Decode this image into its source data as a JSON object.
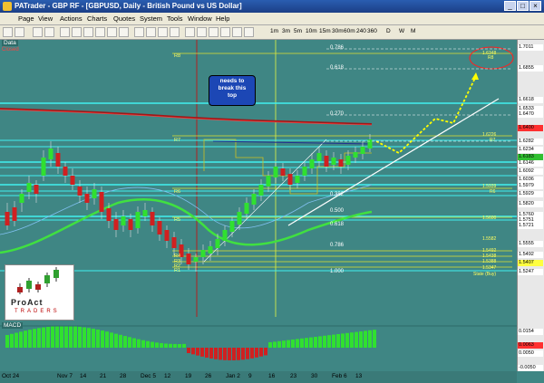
{
  "window": {
    "title": "PATrader - GBP RF - [GBPUSD, Daily - British Pound vs US Dollar]"
  },
  "menu": [
    "Page",
    "View",
    "Actions",
    "Charts",
    "Quotes",
    "System",
    "Tools",
    "Window",
    "Help"
  ],
  "timeframes": [
    "1m",
    "3m",
    "5m",
    "10m",
    "15m",
    "30m",
    "60m",
    "240",
    "360",
    "D",
    "W",
    "M"
  ],
  "panels": {
    "data_label": "Data",
    "closed_label": "Closed",
    "macd_label": "MACD"
  },
  "callout": {
    "line1": "needs to",
    "line2": "break this",
    "line3": "top"
  },
  "logo": {
    "text1": "ProAct",
    "text2": "TRADERS"
  },
  "fib_labels": [
    {
      "text": "0.786",
      "color": "#ffffff"
    },
    {
      "text": "0.618",
      "color": "#ffffff"
    },
    {
      "text": "0.270",
      "color": "#ffffff"
    },
    {
      "text": "0.382",
      "color": "#ffffff"
    },
    {
      "text": "0.500",
      "color": "#ffffff"
    },
    {
      "text": "0.618",
      "color": "#ffffff"
    },
    {
      "text": "0.786",
      "color": "#ffffff"
    },
    {
      "text": "1.000",
      "color": "#ffffff"
    }
  ],
  "pivot_labels": [
    "R8",
    "R7",
    "R6",
    "R5",
    "R4",
    "R3",
    "R2",
    "R1"
  ],
  "right_small_labels": [
    "1.6348",
    "R8",
    "1.6226",
    "R7",
    "1.5939",
    "R6",
    "1.5600",
    "1.5582",
    "1.5492",
    "1.5438",
    "1.5388",
    "1.5347",
    "State (Buy)"
  ],
  "price_axis": [
    {
      "text": "1.7011",
      "bg": "#ffffff"
    },
    {
      "text": "1.6855",
      "bg": "#ffffff"
    },
    {
      "text": "1.6618",
      "bg": "#ffffff"
    },
    {
      "text": "1.6533",
      "bg": "#ffffff"
    },
    {
      "text": "1.6470",
      "bg": "#ffffff"
    },
    {
      "text": "1.6400",
      "bg": "#ff3030"
    },
    {
      "text": "1.6282",
      "bg": "#ffffff"
    },
    {
      "text": "1.6234",
      "bg": "#ffffff"
    },
    {
      "text": "1.6183",
      "bg": "#30c030"
    },
    {
      "text": "1.6146",
      "bg": "#ffffff"
    },
    {
      "text": "1.6092",
      "bg": "#ffffff"
    },
    {
      "text": "1.6036",
      "bg": "#ffffff"
    },
    {
      "text": "1.5979",
      "bg": "#ffffff"
    },
    {
      "text": "1.5929",
      "bg": "#ffffff"
    },
    {
      "text": "1.5820",
      "bg": "#ffffff"
    },
    {
      "text": "1.5760",
      "bg": "#ffffff"
    },
    {
      "text": "1.5751",
      "bg": "#ffffff"
    },
    {
      "text": "1.5721",
      "bg": "#ffffff"
    },
    {
      "text": "1.5555",
      "bg": "#ffffff"
    },
    {
      "text": "1.5492",
      "bg": "#ffffff"
    },
    {
      "text": "1.5407",
      "bg": "#ffff40"
    },
    {
      "text": "1.5247",
      "bg": "#ffffff"
    }
  ],
  "macd_axis": [
    {
      "text": "0.0154",
      "bg": "#ffffff"
    },
    {
      "text": "0.0063",
      "bg": "#ff3030"
    },
    {
      "text": "0.0050",
      "bg": "#ffffff"
    },
    {
      "text": "-0.0050",
      "bg": "#ffffff"
    }
  ],
  "date_axis": [
    "Oct 24",
    "Nov 7",
    "14",
    "21",
    "28",
    "Dec 5",
    "12",
    "19",
    "26",
    "Jan 2",
    "9",
    "16",
    "23",
    "30",
    "Feb 6",
    "13"
  ]
}
